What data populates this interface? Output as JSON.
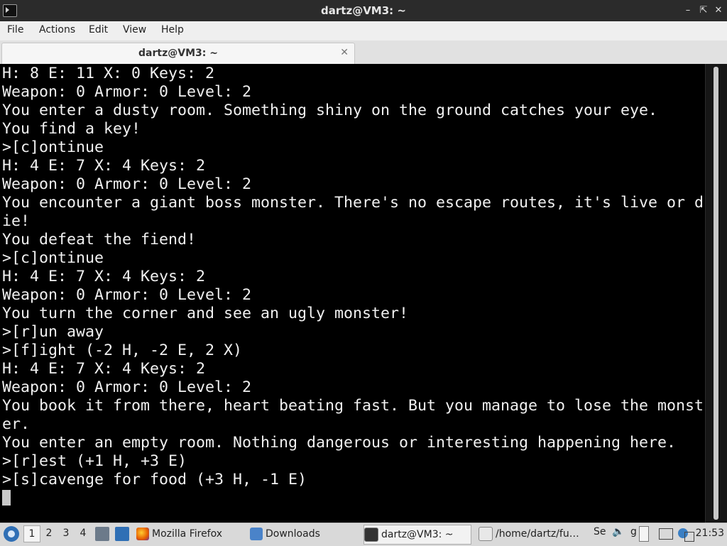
{
  "window": {
    "title": "dartz@VM3: ~"
  },
  "menu": [
    "File",
    "Actions",
    "Edit",
    "View",
    "Help"
  ],
  "tab": {
    "label": "dartz@VM3: ~"
  },
  "terminal": {
    "lines": [
      "H: 8 E: 11 X: 0 Keys: 2",
      "Weapon: 0 Armor: 0 Level: 2",
      "You enter a dusty room. Something shiny on the ground catches your eye.",
      "You find a key!",
      ">[c]ontinue",
      "H: 4 E: 7 X: 4 Keys: 2",
      "Weapon: 0 Armor: 0 Level: 2",
      "You encounter a giant boss monster. There's no escape routes, it's live or d",
      "ie!",
      "You defeat the fiend!",
      ">[c]ontinue",
      "H: 4 E: 7 X: 4 Keys: 2",
      "Weapon: 0 Armor: 0 Level: 2",
      "You turn the corner and see an ugly monster!",
      ">[r]un away",
      ">[f]ight (-2 H, -2 E, 2 X)",
      "H: 4 E: 7 X: 4 Keys: 2",
      "Weapon: 0 Armor: 0 Level: 2",
      "You book it from there, heart beating fast. But you manage to lose the monst",
      "er.",
      "You enter an empty room. Nothing dangerous or interesting happening here.",
      ">[r]est (+1 H, +3 E)",
      ">[s]cavenge for food (+3 H, -1 E)"
    ]
  },
  "taskbar": {
    "workspaces": [
      "1",
      "2",
      "3",
      "4"
    ],
    "tasks": [
      {
        "label": "Mozilla Firefox",
        "icon": "firefox-icon"
      },
      {
        "label": "Downloads",
        "icon": "folder-icon"
      },
      {
        "label": "dartz@VM3: ~",
        "icon": "terminal-icon"
      },
      {
        "label": "/home/dartz/fu…",
        "icon": "text-editor-icon"
      }
    ],
    "tray_text": {
      "se": "Se",
      "g": "g"
    },
    "clock": "21:53"
  },
  "colors": {
    "terminal_bg": "#000000",
    "terminal_fg": "#f0f0f0",
    "titlebar": "#2b2b2b",
    "taskbar": "#d9d9d9"
  }
}
